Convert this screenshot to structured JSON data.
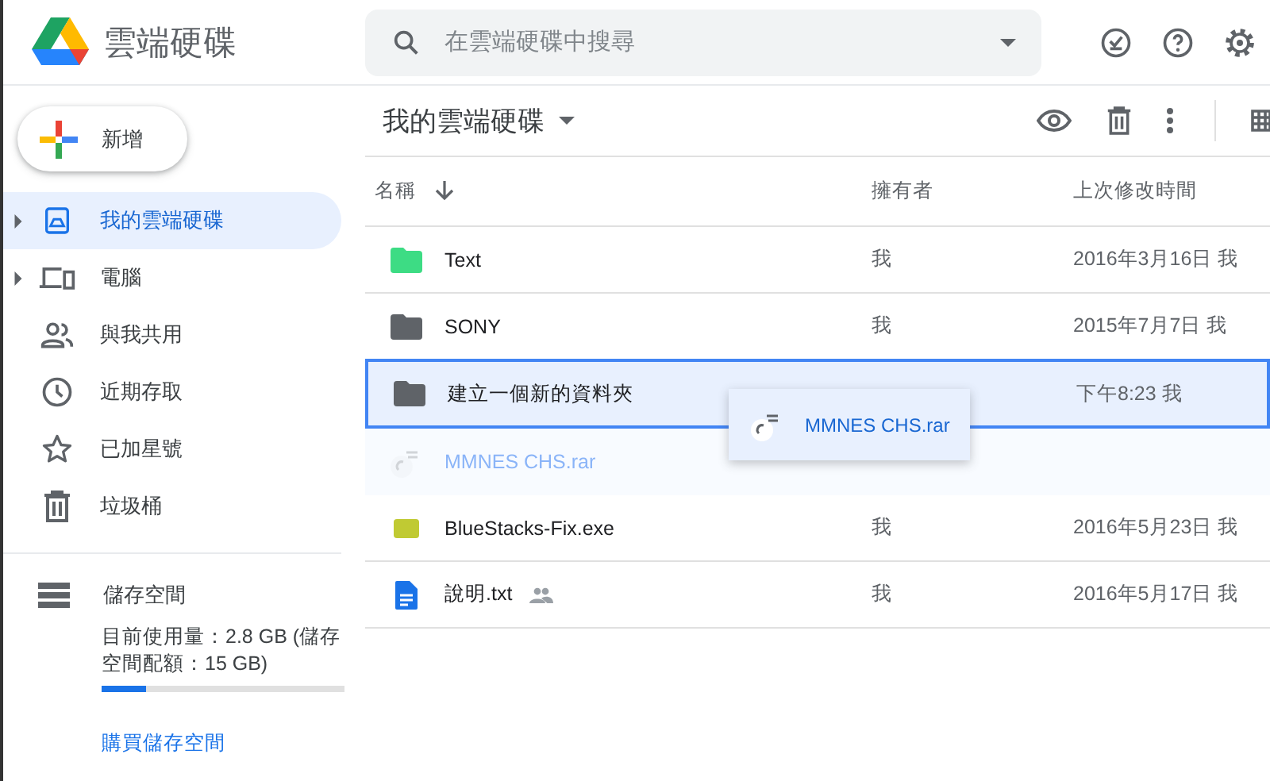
{
  "app": {
    "title": "雲端硬碟"
  },
  "search": {
    "placeholder": "在雲端硬碟中搜尋"
  },
  "new_button": {
    "label": "新增"
  },
  "sidebar": {
    "items": [
      {
        "label": "我的雲端硬碟",
        "selected": true,
        "expandable": true
      },
      {
        "label": "電腦",
        "selected": false,
        "expandable": true
      },
      {
        "label": "與我共用",
        "selected": false,
        "expandable": false
      },
      {
        "label": "近期存取",
        "selected": false,
        "expandable": false
      },
      {
        "label": "已加星號",
        "selected": false,
        "expandable": false
      },
      {
        "label": "垃圾桶",
        "selected": false,
        "expandable": false
      }
    ],
    "storage": {
      "label": "儲存空間",
      "usage": "目前使用量：2.8 GB (儲存空間配額：15 GB)",
      "level": 0.18,
      "link": "購買儲存空間"
    }
  },
  "main": {
    "title": "我的雲端硬碟"
  },
  "table": {
    "columns": [
      "名稱",
      "擁有者",
      "上次修改時間"
    ],
    "rows": [
      {
        "kind": "folder",
        "color": "#3ddc84",
        "name": "Text",
        "owner": "我",
        "modified": "2016年3月16日 我",
        "selected": false,
        "shared": false
      },
      {
        "kind": "folder",
        "color": "#5f6368",
        "name": "SONY",
        "owner": "我",
        "modified": "2015年7月7日 我",
        "selected": false,
        "shared": false
      },
      {
        "kind": "folder",
        "color": "#5f6368",
        "name": "建立一個新的資料夾",
        "modified": "下午8:23 我",
        "selected": true,
        "shared": false
      },
      {
        "kind": "ghost",
        "name": "MMNES CHS.rar",
        "selected": false,
        "shared": false
      },
      {
        "kind": "exe",
        "name": "BlueStacks-Fix.exe",
        "owner": "我",
        "modified": "2016年5月23日 我",
        "selected": false,
        "shared": false
      },
      {
        "kind": "doc",
        "name": "說明.txt",
        "owner": "我",
        "modified": "2016年5月17日 我",
        "selected": false,
        "shared": true
      }
    ]
  },
  "drag": {
    "label": "MMNES CHS.rar"
  }
}
